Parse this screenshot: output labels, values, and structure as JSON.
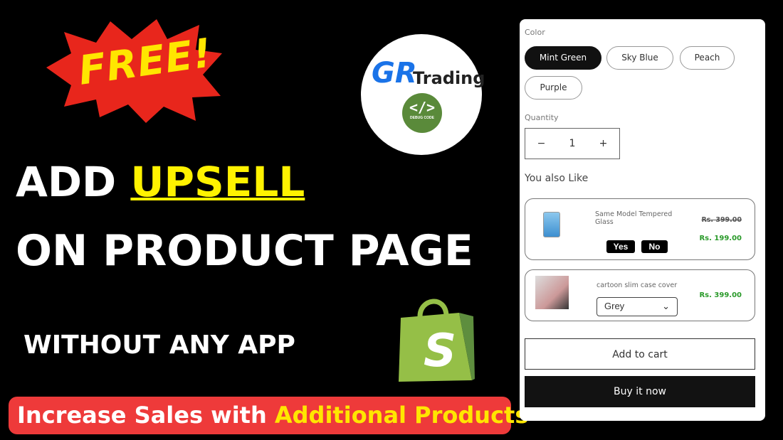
{
  "badge": {
    "text": "FREE!",
    "color": "#e8261c"
  },
  "headline": {
    "line1_prefix": "ADD",
    "line1_highlight": "UPSELL",
    "line2": "ON PRODUCT PAGE",
    "line3": "WITHOUT ANY APP"
  },
  "logo": {
    "mark": "GR",
    "name": "Trading",
    "sub_icon": "</>",
    "sub_text": "DEBUG CODE"
  },
  "cta": {
    "prefix": "Increase Sales with",
    "highlight": "Additional Products"
  },
  "shopify_icon": "shopify-bag-icon",
  "product": {
    "color_label": "Color",
    "colors": [
      "Mint Green",
      "Sky Blue",
      "Peach",
      "Purple"
    ],
    "selected_color": "Mint Green",
    "quantity_label": "Quantity",
    "quantity": "1",
    "minus": "−",
    "plus": "+",
    "upsell_title": "You also Like",
    "upsells": [
      {
        "name": "Same Model Tempered Glass",
        "old_price": "Rs. 399.00",
        "price": "Rs. 199.00",
        "yes": "Yes",
        "no": "No"
      },
      {
        "name": "cartoon slim case cover",
        "price": "Rs. 399.00",
        "variant": "Grey"
      }
    ],
    "add_to_cart": "Add to cart",
    "buy_now": "Buy it now"
  }
}
